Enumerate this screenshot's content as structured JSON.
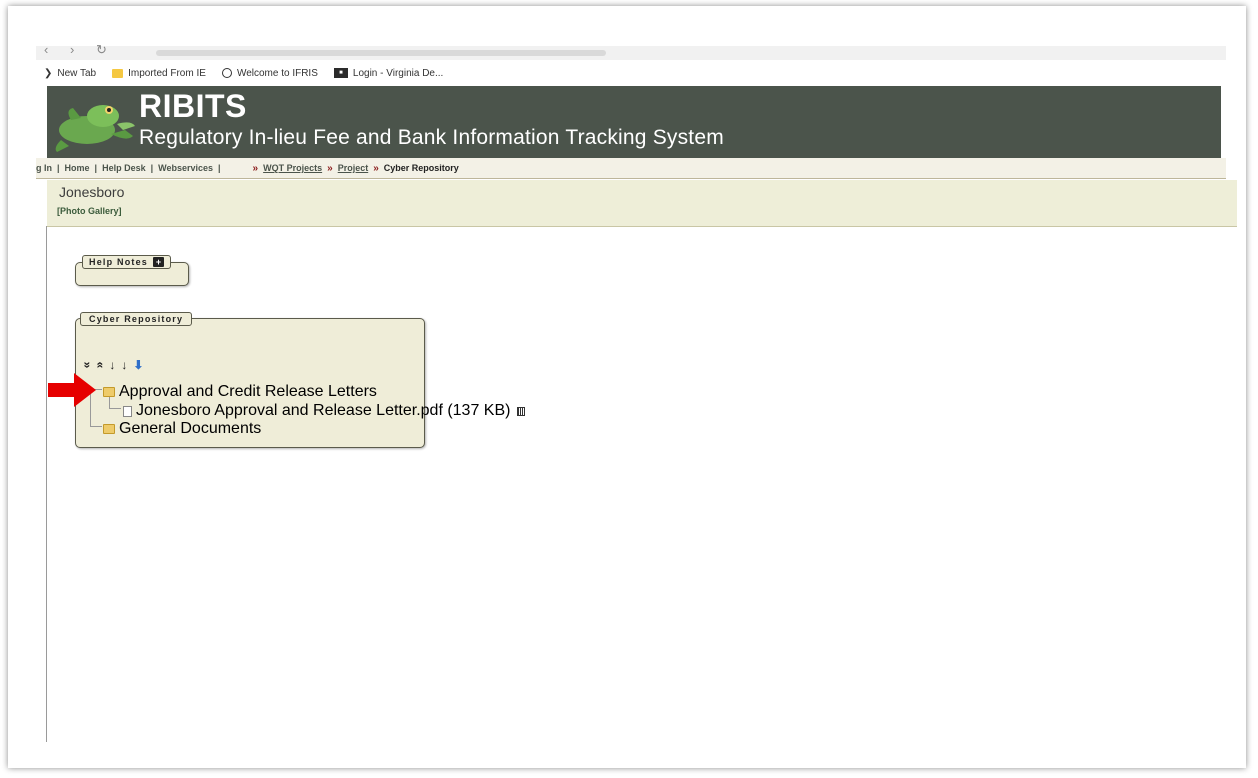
{
  "browser": {
    "bookmarks": [
      {
        "label": "New Tab",
        "icon": "tab-icon"
      },
      {
        "label": "Imported From IE",
        "icon": "folder-icon"
      },
      {
        "label": "Welcome to IFRIS",
        "icon": "globe-icon"
      },
      {
        "label": "Login - Virginia De...",
        "icon": "login-icon"
      }
    ]
  },
  "header": {
    "title": "RIBITS",
    "subtitle": "Regulatory In-lieu Fee and Bank Information Tracking System"
  },
  "nav": {
    "login": "g In",
    "home": "Home",
    "helpdesk": "Help Desk",
    "webservices": "Webservices",
    "sep": "|",
    "raquo": "»",
    "crumbs": {
      "wqt_projects": "WQT Projects",
      "project": "Project",
      "current": "Cyber Repository"
    }
  },
  "project": {
    "name": "Jonesboro",
    "bracket_open": "[",
    "gallery": "Photo Gallery",
    "bracket_close": "]"
  },
  "help_notes": {
    "label": "Help Notes",
    "toggle": "+"
  },
  "repository": {
    "label": "Cyber Repository",
    "toolbar": {
      "expand_all": "»",
      "collapse_all": "«",
      "sort_asc": "↓",
      "sort_desc": "↓",
      "download": "⬇"
    },
    "tree": {
      "folder1": "Approval and Credit Release Letters",
      "file1": "Jonesboro Approval and Release Letter.pdf (137 KB)",
      "folder2": "General Documents"
    }
  },
  "colors": {
    "banner": "#4b544b",
    "accent": "#eeeed8",
    "arrow": "#e60000"
  }
}
